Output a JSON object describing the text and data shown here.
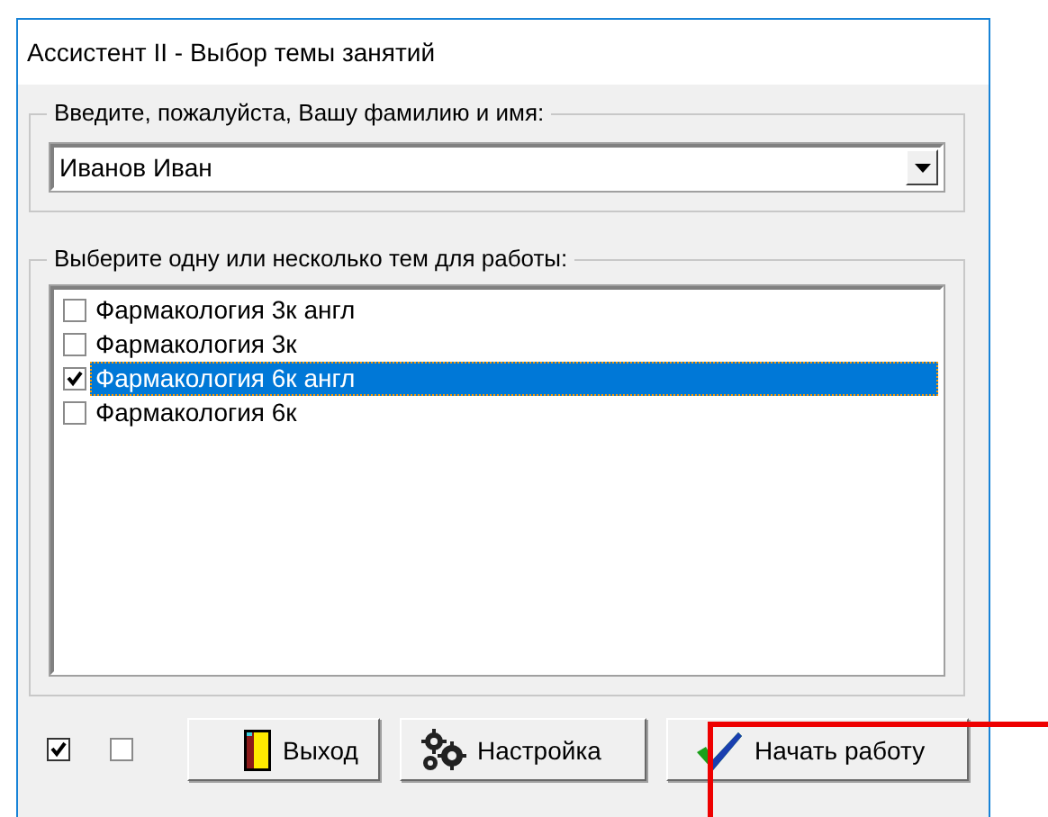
{
  "window": {
    "title": "Ассистент II - Выбор темы занятий"
  },
  "name_group": {
    "legend": "Введите, пожалуйста, Вашу фамилию и имя:",
    "value": "Иванов Иван"
  },
  "topics_group": {
    "legend": "Выберите одну или несколько тем для работы:",
    "items": [
      {
        "label": "Фармакология 3к англ",
        "checked": false,
        "selected": false
      },
      {
        "label": "Фармакология 3к",
        "checked": false,
        "selected": false
      },
      {
        "label": "Фармакология 6к англ",
        "checked": true,
        "selected": true
      },
      {
        "label": "Фармакология 6к",
        "checked": false,
        "selected": false
      }
    ]
  },
  "bottom_checkboxes": [
    {
      "checked": true
    },
    {
      "checked": false
    }
  ],
  "buttons": [
    {
      "kind": "exit",
      "label": "Выход"
    },
    {
      "kind": "settings",
      "label": "Настройка"
    },
    {
      "kind": "start",
      "label": "Начать работу"
    }
  ]
}
